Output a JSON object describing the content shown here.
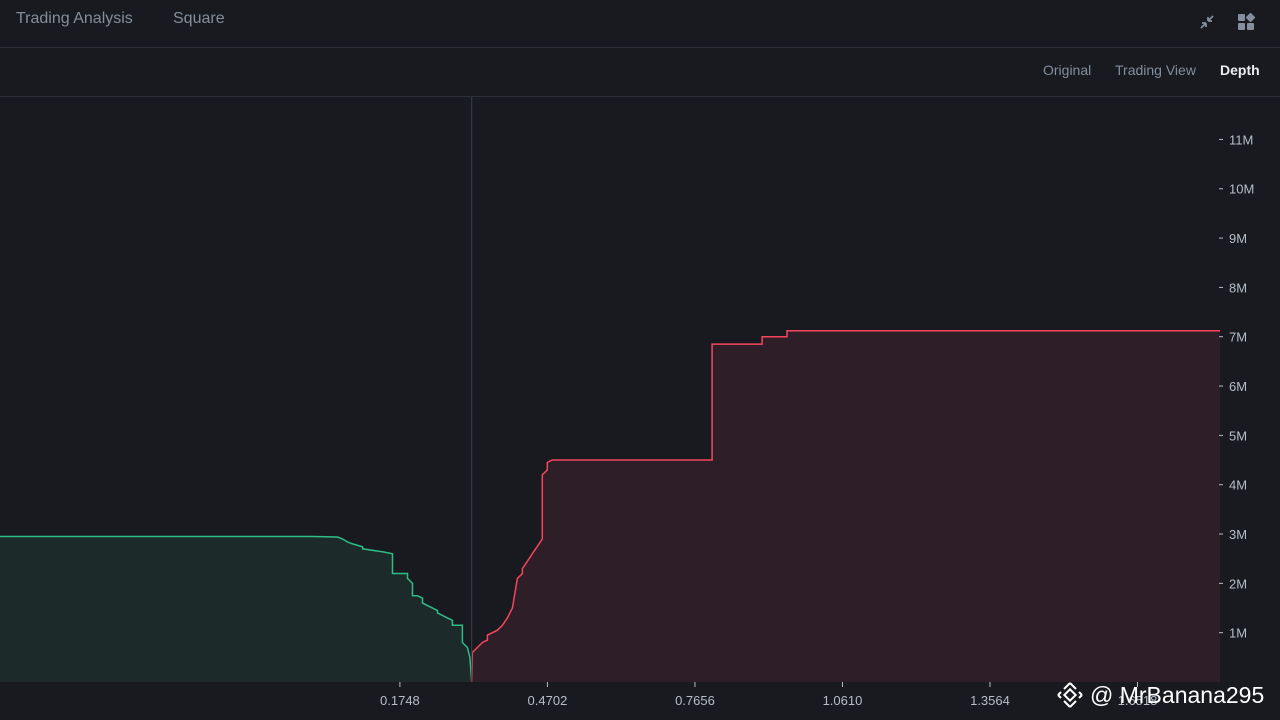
{
  "header": {
    "tabs": [
      {
        "label": "Trading Analysis"
      },
      {
        "label": "Square"
      }
    ],
    "icons": [
      "collapse-icon",
      "grid-layout-icon"
    ]
  },
  "view_switch": {
    "options": [
      {
        "label": "Original"
      },
      {
        "label": "Trading View"
      },
      {
        "label": "Depth"
      }
    ],
    "active": "Depth"
  },
  "colors": {
    "bid_line": "#2ebd85",
    "bid_fill": "#1c2a2a",
    "ask_line": "#f6465d",
    "ask_fill": "#2e1e27",
    "axis_text": "#b7bdc6",
    "mid_line": "#3a3f47"
  },
  "watermark": {
    "text": "@ MrBanana295",
    "icon": "binance-logo-icon"
  },
  "chart_data": {
    "type": "area",
    "title": "",
    "xlabel": "",
    "ylabel": "",
    "x_tick_labels": [
      "0.1748",
      "0.4702",
      "0.7656",
      "1.0610",
      "1.3564",
      "1.6518"
    ],
    "x_ticks": [
      0.1748,
      0.4702,
      0.7656,
      1.061,
      1.3564,
      1.6518
    ],
    "y_tick_labels": [
      "1M",
      "2M",
      "3M",
      "4M",
      "5M",
      "6M",
      "7M",
      "8M",
      "9M",
      "10M",
      "11M"
    ],
    "y_ticks": [
      1,
      2,
      3,
      4,
      5,
      6,
      7,
      8,
      9,
      10,
      11
    ],
    "xlim": [
      -0.626,
      1.817
    ],
    "ylim": [
      0,
      11.86
    ],
    "y_unit": "M",
    "mid_price": 0.3186,
    "grid": false,
    "series": [
      {
        "side": "bid",
        "x": [
          -0.626,
          0.0,
          0.05,
          0.06,
          0.07,
          0.08,
          0.1,
          0.1,
          0.14,
          0.16,
          0.16,
          0.19,
          0.19,
          0.195,
          0.2,
          0.2,
          0.21,
          0.22,
          0.22,
          0.25,
          0.25,
          0.26,
          0.27,
          0.28,
          0.28,
          0.3,
          0.3,
          0.31,
          0.315,
          0.3186
        ],
        "y": [
          2.95,
          2.95,
          2.94,
          2.9,
          2.84,
          2.8,
          2.74,
          2.7,
          2.64,
          2.6,
          2.2,
          2.2,
          2.1,
          2.05,
          2.0,
          1.75,
          1.75,
          1.7,
          1.6,
          1.45,
          1.4,
          1.35,
          1.3,
          1.25,
          1.15,
          1.15,
          0.8,
          0.7,
          0.5,
          0.0
        ]
      },
      {
        "side": "ask",
        "x": [
          0.3186,
          0.32,
          0.33,
          0.34,
          0.35,
          0.35,
          0.36,
          0.37,
          0.38,
          0.39,
          0.4,
          0.41,
          0.42,
          0.42,
          0.43,
          0.44,
          0.45,
          0.46,
          0.46,
          0.47,
          0.47,
          0.48,
          0.48,
          0.49,
          0.5,
          0.5,
          0.6,
          0.7,
          0.8,
          0.8,
          0.9,
          0.9,
          0.95,
          0.95,
          1.817
        ],
        "y": [
          0.0,
          0.6,
          0.7,
          0.8,
          0.85,
          0.95,
          1.0,
          1.05,
          1.15,
          1.3,
          1.5,
          2.1,
          2.2,
          2.3,
          2.45,
          2.6,
          2.75,
          2.9,
          4.2,
          4.3,
          4.45,
          4.5,
          4.5,
          4.5,
          4.5,
          4.5,
          4.5,
          4.5,
          4.5,
          6.85,
          6.85,
          7.0,
          7.0,
          7.12,
          7.12
        ]
      }
    ]
  }
}
